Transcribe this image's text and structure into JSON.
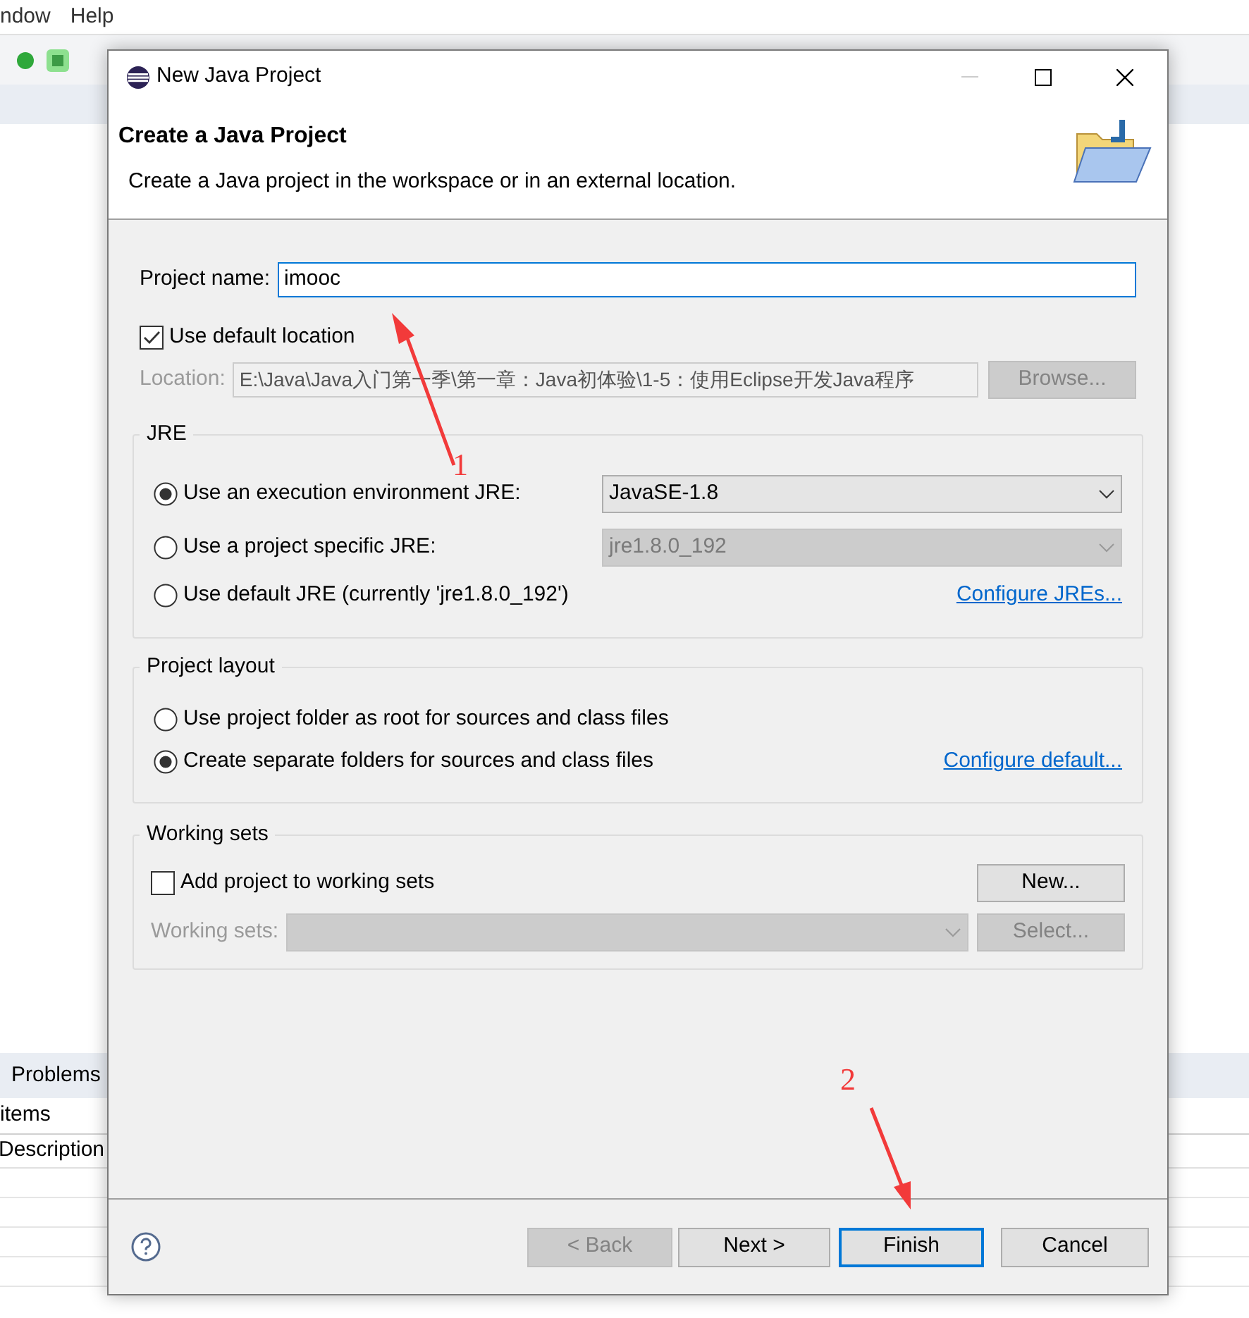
{
  "ide": {
    "menu": [
      "ndow",
      "Help"
    ],
    "panel_tab": "Problems",
    "items_label": "items",
    "column_header": "Description"
  },
  "window": {
    "title": "New Java Project"
  },
  "header": {
    "title": "Create a Java Project",
    "description": "Create a Java project in the workspace or in an external location."
  },
  "project_name": {
    "label": "Project name:",
    "value": "imooc"
  },
  "default_location": {
    "label": "Use default location",
    "checked": true
  },
  "location": {
    "label": "Location:",
    "value": "E:\\Java\\Java入门第一季\\第一章：Java初体验\\1-5：使用Eclipse开发Java程序",
    "disabled": true,
    "button": {
      "label": "Browse...",
      "disabled": true
    }
  },
  "jre": {
    "title": "JRE",
    "options": [
      {
        "label": "Use an execution environment JRE:",
        "selected": true,
        "dropdown": {
          "value": "JavaSE-1.8",
          "disabled": false
        }
      },
      {
        "label": "Use a project specific JRE:",
        "selected": false,
        "dropdown": {
          "value": "jre1.8.0_192",
          "disabled": true
        }
      },
      {
        "label": "Use default JRE (currently 'jre1.8.0_192')",
        "selected": false,
        "link": "Configure JREs..."
      }
    ]
  },
  "project_layout": {
    "title": "Project layout",
    "options": [
      {
        "label": "Use project folder as root for sources and class files",
        "selected": false
      },
      {
        "label": "Create separate folders for sources and class files",
        "selected": true,
        "link": "Configure default..."
      }
    ]
  },
  "working_sets": {
    "title": "Working sets",
    "checkbox": {
      "label": "Add project to working sets",
      "checked": false
    },
    "new_button": {
      "label": "New...",
      "disabled": false
    },
    "combo_label": "Working sets:",
    "combo_disabled": true,
    "select_button": {
      "label": "Select...",
      "disabled": true
    }
  },
  "buttons": [
    {
      "label": "< Back",
      "disabled": true
    },
    {
      "label": "Next >",
      "disabled": false,
      "default": false
    },
    {
      "label": "Finish",
      "disabled": false,
      "default": true
    },
    {
      "label": "Cancel",
      "disabled": false,
      "default": false
    }
  ],
  "annotations": [
    {
      "label": "1"
    },
    {
      "label": "2"
    }
  ]
}
